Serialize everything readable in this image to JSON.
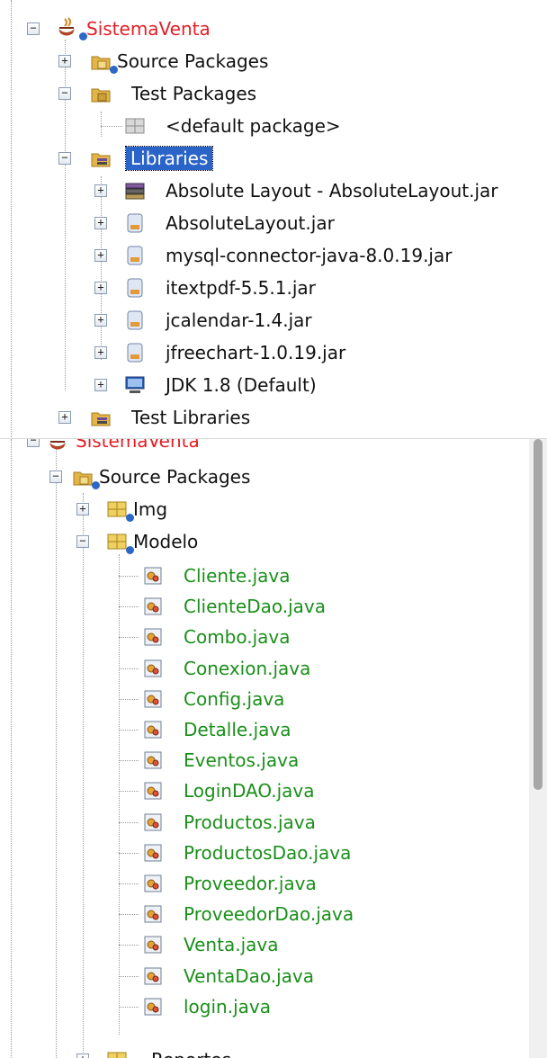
{
  "top_tree": {
    "project": "SistemaVenta",
    "source_packages": "Source Packages",
    "test_packages": "Test Packages",
    "default_package": "<default package>",
    "libraries": "Libraries",
    "library_items": [
      "Absolute Layout - AbsoluteLayout.jar",
      "AbsoluteLayout.jar",
      "mysql-connector-java-8.0.19.jar",
      "itextpdf-5.5.1.jar",
      "jcalendar-1.4.jar",
      "jfreechart-1.0.19.jar",
      "JDK 1.8 (Default)"
    ],
    "test_libraries": "Test Libraries"
  },
  "bottom_tree": {
    "project": "SistemaVenta",
    "source_packages": "Source Packages",
    "pkg_img": "Img",
    "pkg_modelo": "Modelo",
    "files": [
      "Cliente.java",
      "ClienteDao.java",
      "Combo.java",
      "Conexion.java",
      "Config.java",
      "Detalle.java",
      "Eventos.java",
      "LoginDAO.java",
      "Productos.java",
      "ProductosDao.java",
      "Proveedor.java",
      "ProveedorDao.java",
      "Venta.java",
      "VentaDao.java",
      "login.java"
    ],
    "next_package": "Reportes"
  },
  "colors": {
    "project_red": "#e41e26",
    "file_green": "#1a8f1a",
    "selection": "#2a64c8"
  }
}
